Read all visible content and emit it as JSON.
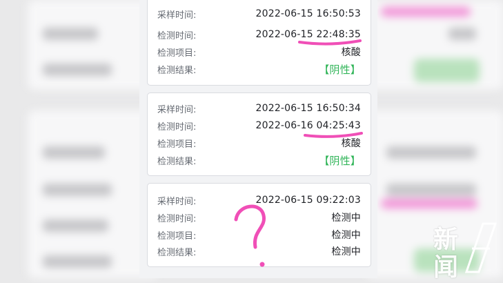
{
  "records": [
    {
      "sample_time_label": "采样时间:",
      "sample_time": "2022-06-15 16:50:53",
      "test_time_label": "检测时间:",
      "test_time": "2022-06-15 22:48:35",
      "item_label": "检测项目:",
      "item": "核酸",
      "result_label": "检测结果:",
      "result": "【阴性】"
    },
    {
      "sample_time_label": "采样时间:",
      "sample_time": "2022-06-15 16:50:34",
      "test_time_label": "检测时间:",
      "test_time": "2022-06-16 04:25:43",
      "item_label": "检测项目:",
      "item": "核酸",
      "result_label": "检测结果:",
      "result": "【阴性】"
    },
    {
      "sample_time_label": "采样时间:",
      "sample_time": "2022-06-15 09:22:03",
      "test_time_label": "检测时间:",
      "test_time": "检测中",
      "item_label": "检测项目:",
      "item": "检测中",
      "result_label": "检测结果:",
      "result": "检测中"
    }
  ],
  "watermark": {
    "char_1": "新",
    "char_2": "闻"
  },
  "colors": {
    "negative_result": "#2fb457",
    "annotation": "#f04fb7"
  },
  "icons": [
    "question-mark-annotation",
    "news-logo-icon"
  ]
}
